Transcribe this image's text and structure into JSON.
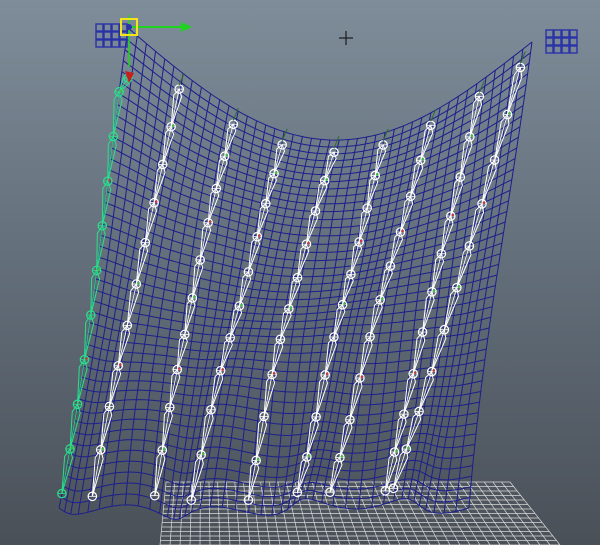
{
  "viewport": {
    "background_top": "#7f8d9a",
    "background_bottom": "#4a5058",
    "camera": "perspective"
  },
  "scene": {
    "cloth_mesh": {
      "wire_color": "#1c1f8c",
      "rows": 44,
      "cols": 44
    },
    "ground_grid": {
      "line_color": "#d9d9d9"
    },
    "joint_chains": {
      "count": 9,
      "selected_index": 0,
      "selected_color": "#29e08c",
      "unselected_color": "#ffffff"
    },
    "locators": {
      "count": 2,
      "color": "#2a33a8"
    },
    "manipulator": {
      "type": "move",
      "x_axis_color": "#1fd41f",
      "y_axis_color": "#c81e1e",
      "handle_color": "#f2e51a"
    },
    "icons": [
      "move-manipulator-icon",
      "pivot-crosshair-icon",
      "locator-icon"
    ]
  }
}
